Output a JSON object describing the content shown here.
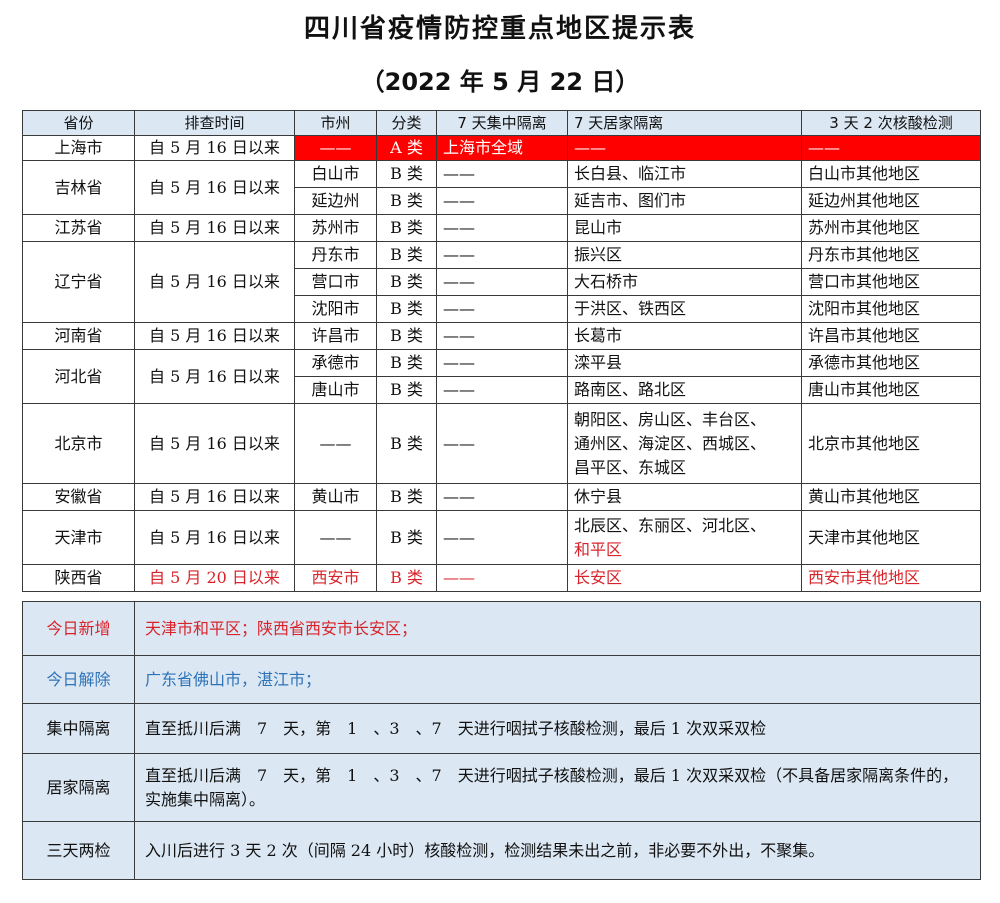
{
  "title": "四川省疫情防控重点地区提示表",
  "subtitle": "（2022 年 5 月 22 日）",
  "headers": [
    "省份",
    "排查时间",
    "市州",
    "分类",
    "7 天集中隔离",
    "7 天居家隔离",
    "3 天 2 次核酸检测"
  ],
  "dash": "——",
  "rows": {
    "shanghai": {
      "prov": "上海市",
      "time": "自 5 月 16 日以来",
      "city": "——",
      "cls": "A 类",
      "central": "上海市全域",
      "home": "——",
      "test": "——"
    },
    "jilin": {
      "prov": "吉林省",
      "time": "自 5 月 16 日以来",
      "c1": {
        "city": "白山市",
        "cls": "B 类",
        "central": "——",
        "home": "长白县、临江市",
        "test": "白山市其他地区"
      },
      "c2": {
        "city": "延边州",
        "cls": "B 类",
        "central": "——",
        "home": "延吉市、图们市",
        "test": "延边州其他地区"
      }
    },
    "jiangsu": {
      "prov": "江苏省",
      "time": "自 5 月 16 日以来",
      "city": "苏州市",
      "cls": "B 类",
      "central": "——",
      "home": "昆山市",
      "test": "苏州市其他地区"
    },
    "liaoning": {
      "prov": "辽宁省",
      "time": "自 5 月 16 日以来",
      "c1": {
        "city": "丹东市",
        "cls": "B 类",
        "central": "——",
        "home": "振兴区",
        "test": "丹东市其他地区"
      },
      "c2": {
        "city": "营口市",
        "cls": "B 类",
        "central": "——",
        "home": "大石桥市",
        "test": "营口市其他地区"
      },
      "c3": {
        "city": "沈阳市",
        "cls": "B 类",
        "central": "——",
        "home": "于洪区、铁西区",
        "test": "沈阳市其他地区"
      }
    },
    "henan": {
      "prov": "河南省",
      "time": "自 5 月 16 日以来",
      "city": "许昌市",
      "cls": "B 类",
      "central": "——",
      "home": "长葛市",
      "test": "许昌市其他地区"
    },
    "hebei": {
      "prov": "河北省",
      "time": "自 5 月 16 日以来",
      "c1": {
        "city": "承德市",
        "cls": "B 类",
        "central": "——",
        "home": "滦平县",
        "test": "承德市其他地区"
      },
      "c2": {
        "city": "唐山市",
        "cls": "B 类",
        "central": "——",
        "home": "路南区、路北区",
        "test": "唐山市其他地区"
      }
    },
    "beijing": {
      "prov": "北京市",
      "time": "自 5 月 16 日以来",
      "city": "——",
      "cls": "B 类",
      "central": "——",
      "home_l1": "朝阳区、房山区、丰台区、",
      "home_l2": "通州区、海淀区、西城区、",
      "home_l3": "昌平区、东城区",
      "test": "北京市其他地区"
    },
    "anhui": {
      "prov": "安徽省",
      "time": "自 5 月 16 日以来",
      "city": "黄山市",
      "cls": "B 类",
      "central": "——",
      "home": "休宁县",
      "test": "黄山市其他地区"
    },
    "tianjin": {
      "prov": "天津市",
      "time": "自 5 月 16 日以来",
      "city": "——",
      "cls": "B 类",
      "central": "——",
      "home_l1": "北辰区、东丽区、河北区、",
      "home_l2": "和平区",
      "test": "天津市其他地区"
    },
    "shaanxi": {
      "prov": "陕西省",
      "time": "自 5 月 20 日以来",
      "city": "西安市",
      "cls": "B 类",
      "central": "——",
      "home": "长安区",
      "test": "西安市其他地区"
    }
  },
  "notes": {
    "new": {
      "label": "今日新增",
      "text": "天津市和平区；陕西省西安市长安区；"
    },
    "lift": {
      "label": "今日解除",
      "text": "广东省佛山市，湛江市；"
    },
    "central": {
      "label": "集中隔离",
      "text": "直至抵川后满　7　天，第　1　、3　、7　天进行咽拭子核酸检测，最后 1 次双采双检"
    },
    "home": {
      "label": "居家隔离",
      "text": "直至抵川后满　7　天，第　1　、3　、7　天进行咽拭子核酸检测，最后 1 次双采双检（不具备居家隔离条件的，实施集中隔离）。"
    },
    "test": {
      "label": "三天两检",
      "text": "入川后进行 3 天 2 次（间隔 24 小时）核酸检测，检测结果未出之前，非必要不外出，不聚集。"
    }
  },
  "colors": {
    "header_bg": "#dbe7f3",
    "highlight_bg": "#ff0000",
    "accent_red": "#d8232a",
    "accent_blue": "#2e73b8"
  }
}
